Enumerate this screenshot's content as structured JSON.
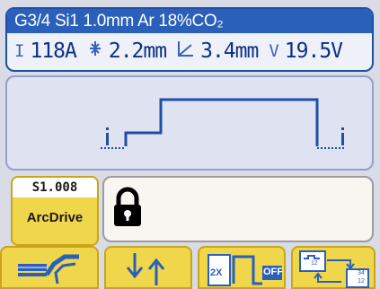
{
  "header": {
    "title": "G3/4 Si1 1.0mm Ar 18%CO₂",
    "current_symbol": "I",
    "current_value": "118A",
    "gap_value": "2.2mm",
    "a_value": "3.4mm",
    "voltage_symbol": "V",
    "voltage_value": "19.5V"
  },
  "program": {
    "number": "S1.008",
    "mode": "ArcDrive"
  },
  "buttons": {
    "twox_label": "2X",
    "off_label": "OFF",
    "mini_34": "34",
    "mini_12a": "12",
    "mini_12b": "12"
  },
  "colors": {
    "title_bar": "#2a5fba",
    "param_text": "#0d2f86",
    "wave": "#1f4ea8",
    "button_yellow": "#f0d64a"
  }
}
